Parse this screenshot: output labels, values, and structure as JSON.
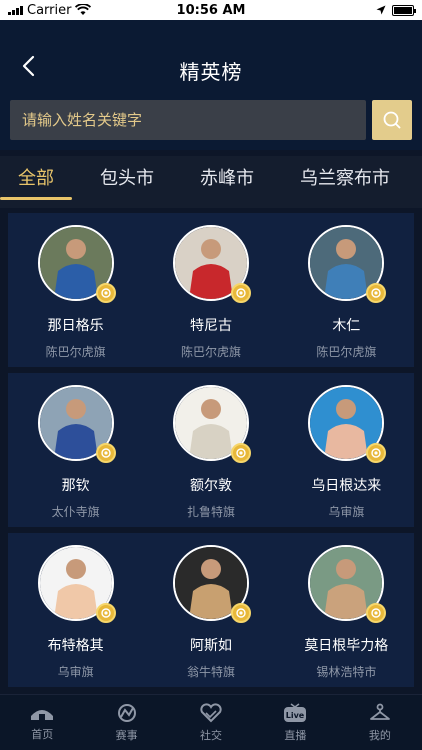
{
  "status_bar": {
    "carrier": "Carrier",
    "time": "10:56 AM"
  },
  "header": {
    "title": "精英榜"
  },
  "search": {
    "placeholder": "请输入姓名关键字"
  },
  "tabs": [
    {
      "label": "全部",
      "active": true
    },
    {
      "label": "包头市",
      "active": false
    },
    {
      "label": "赤峰市",
      "active": false
    },
    {
      "label": "乌兰察布市",
      "active": false
    }
  ],
  "athletes": [
    {
      "name": "那日格乐",
      "region": "陈巴尔虎旗",
      "bg": "#6b7a5c",
      "shirt": "#2b5ea8"
    },
    {
      "name": "特尼古",
      "region": "陈巴尔虎旗",
      "bg": "#d9d1c6",
      "shirt": "#c8282c"
    },
    {
      "name": "木仁",
      "region": "陈巴尔虎旗",
      "bg": "#4d6a7a",
      "shirt": "#3f7fb8"
    },
    {
      "name": "那钦",
      "region": "太仆寺旗",
      "bg": "#8ea3b5",
      "shirt": "#2d4f9a"
    },
    {
      "name": "额尔敦",
      "region": "扎鲁特旗",
      "bg": "#f2f0ea",
      "shirt": "#d8d2c4"
    },
    {
      "name": "乌日根达来",
      "region": "乌审旗",
      "bg": "#2f8fd0",
      "shirt": "#e8b8a0"
    },
    {
      "name": "布特格其",
      "region": "乌审旗",
      "bg": "#f4f4f4",
      "shirt": "#f0c8a8"
    },
    {
      "name": "阿斯如",
      "region": "翁牛特旗",
      "bg": "#2a2a2a",
      "shirt": "#c8a070"
    },
    {
      "name": "莫日根毕力格",
      "region": "锡林浩特市",
      "bg": "#7a9a84",
      "shirt": "#caa27c"
    }
  ],
  "bottom_nav": [
    {
      "label": "首页",
      "icon": "home-icon"
    },
    {
      "label": "赛事",
      "icon": "event-icon"
    },
    {
      "label": "社交",
      "icon": "social-icon"
    },
    {
      "label": "直播",
      "icon": "live-icon",
      "badge": "Live"
    },
    {
      "label": "我的",
      "icon": "profile-icon"
    }
  ],
  "colors": {
    "accent": "#e8c46a",
    "panel": "#112140",
    "background": "#0d1628"
  }
}
